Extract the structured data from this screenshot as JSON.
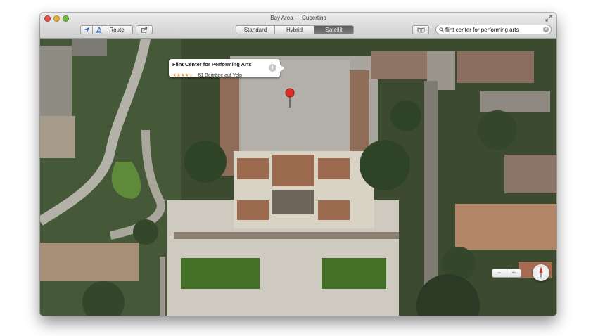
{
  "window": {
    "title": "Bay Area — Cupertino"
  },
  "toolbar": {
    "route_label": "Route",
    "map_modes": [
      {
        "label": "Standard",
        "active": false
      },
      {
        "label": "Hybrid",
        "active": false
      },
      {
        "label": "Satellit",
        "active": true
      }
    ],
    "search_value": "flint center for performing arts"
  },
  "callout": {
    "name": "Flint Center for Performing Arts",
    "stars": "★★★★☆",
    "reviews": "61 Beiträge auf Yelp",
    "rating": 4
  },
  "zoom": {
    "minus": "−",
    "plus": "+"
  },
  "colors": {
    "pin": "#e22a2a",
    "active_mode": "#6b6b6b",
    "stars": "#e7862b"
  }
}
